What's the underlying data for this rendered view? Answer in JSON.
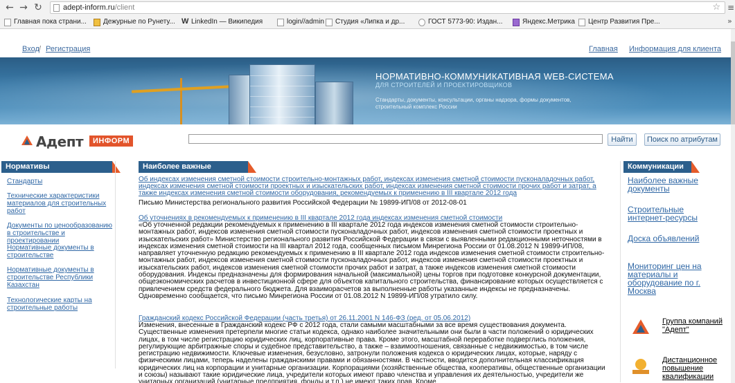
{
  "browser": {
    "url_host": "adept-inform.ru",
    "url_path": "/client",
    "bookmarks": [
      {
        "label": "Главная пока страни...",
        "icon": "page-icon"
      },
      {
        "label": "Дежурные по Рунету...",
        "icon": "shield-icon"
      },
      {
        "label": "LinkedIn — Википедия",
        "icon": "wikipedia-icon"
      },
      {
        "label": "login//admin",
        "icon": "page-icon"
      },
      {
        "label": "Студия «Липка и др...",
        "icon": "page-icon"
      },
      {
        "label": "ГОСТ 5773-90: Издан...",
        "icon": "globe-icon"
      },
      {
        "label": "Яндекс.Метрика",
        "icon": "metrika-icon"
      },
      {
        "label": "Центр Развития Пре...",
        "icon": "page-icon"
      }
    ]
  },
  "toplinks": {
    "login": "Вход",
    "sep": "/",
    "register": "Регистрация",
    "home": "Главная",
    "client_info": "Информация для клиента"
  },
  "banner": {
    "title": "НОРМАТИВНО-КОММУНИКАТИВНАЯ WEB-СИСТЕМА",
    "subtitle": "ДЛЯ СТРОИТЕЛЕЙ И ПРОЕКТИРОВЩИКОВ",
    "desc": "Стандарты, документы, консультации, органы надзора, формы документов, строительный комплекс России"
  },
  "logo": {
    "name": "Адепт",
    "badge": "ИНФОРМ"
  },
  "search": {
    "value": "",
    "find_label": "Найти",
    "attr_label": "Поиск по атрибутам"
  },
  "left": {
    "title": "Нормативы",
    "items": [
      "Стандарты",
      "Технические характеристики материалов для строительных работ",
      "Документы по ценообразованию в строительстве и проектировании",
      "Нормативные документы в строительстве",
      "Нормативные документы в строительстве Республики Казахстан",
      "Технологические карты на строительные работы"
    ]
  },
  "main": {
    "title": "Наиболее важные документы",
    "doc1_link": "Об индексах изменения сметной стоимости строительно-монтажных работ, индексах изменения сметной стоимости пусконаладочных работ, индексах изменения сметной стоимости проектных и изыскательских работ, индексах изменения сметной стоимости прочих работ и затрат, а также индексах изменения сметной стоимости оборудования, рекомендуемых к применению в III квартале 2012 года",
    "doc1_text": "Письмо Министерства регионального развития Российской Федерации № 19899-ИП/08 от 2012-08-01",
    "doc2_link": "Об уточнениях в рекомендуемых к применению в III квартале 2012 года индексах изменения сметной стоимости",
    "doc2_text": "«Об уточненной редакции рекомендуемых к применению в III квартале 2012 года индексов изменения сметной стоимости строительно-монтажных работ, индексов изменения сметной стоимости пусконаладочных работ, индексов изменения сметной стоимости проектных и изыскательских работ» Министерство регионального развития Российской Федерации в связи с выявленными редакционными неточностями в индексах изменения сметной стоимости на III квартал 2012 года, сообщенных письмом Минрегиона России от 01.08.2012 N 19899-ИП/08, направляет уточненную редакцию рекомендуемых к применению в III квартале 2012 года индексов изменения сметной стоимости строительно-монтажных работ, индексов изменения сметной стоимости пусконаладочных работ, индексов изменения сметной стоимости проектных и изыскательских работ, индексов изменения сметной стоимости прочих работ и затрат, а также индексов изменения сметной стоимости оборудования. Индексы предназначены для формирования начальной (максимальной) цены торгов при подготовке конкурсной документации, общеэкономических расчетов в инвестиционной сфере для объектов капитального строительства, финансирование которых осуществляется с привлечением средств федерального бюджета. Для взаиморасчетов за выполненные работы указанные индексы не предназначены. Одновременно сообщается, что письмо Минрегиона России от 01.08.2012 N 19899-ИП/08 утратило силу.",
    "doc3_link": "Гражданский кодекс Российской Федерации (часть третья) от 26.11.2001 N 146-ФЗ (ред. от 05.06.2012)",
    "doc3_text": "Изменения, внесенные в Гражданский кодекс РФ с 2012 года, стали самыми масштабными за все время существования документа. Существенные изменения претерпели многие статьи кодекса, однако наиболее значительными они были в части положений о юридических лицах, в том числе регистрацию юридических лиц, корпоративные права. Кроме этого, масштабной переработке подверглись положения, регулирующие арбитражные споры и судебное представительство, а также – взаимоотношения, связанные с недвижимостью, в том числе регистрацию недвижимости. Ключевые изменения, безусловно, затронули положения кодекса о юридических лицах, которые, наряду с физическими лицами, теперь наделены гражданскими правами и обязанностями. В частности, вводится дополнительная классификация юридических лиц на корпорации и унитарные организации. Корпорациями (хозяйственные общества, кооперативы, общественные организации и союзы) называют такие юридические лица, учредители которых имеют право членства и управления их деятельностью, учредители же унитарных организаций (унитарные предприятия, фонды и т.п.) не имеют таких прав. Кроме"
  },
  "right": {
    "title": "Коммуникации",
    "items": [
      "Наиболее важные документы",
      "Строительные интернет-ресурсы",
      "Доска объявлений",
      "Мониторинг цен на материалы и оборудование по г. Москва"
    ],
    "partner1": "Группа компаний \"Адепт\"",
    "partner2": "Дистанционное повышение квалификации"
  },
  "colors": {
    "link": "#2f67a5",
    "panel_head": "#2c5f8c",
    "accent": "#e55b2a"
  }
}
